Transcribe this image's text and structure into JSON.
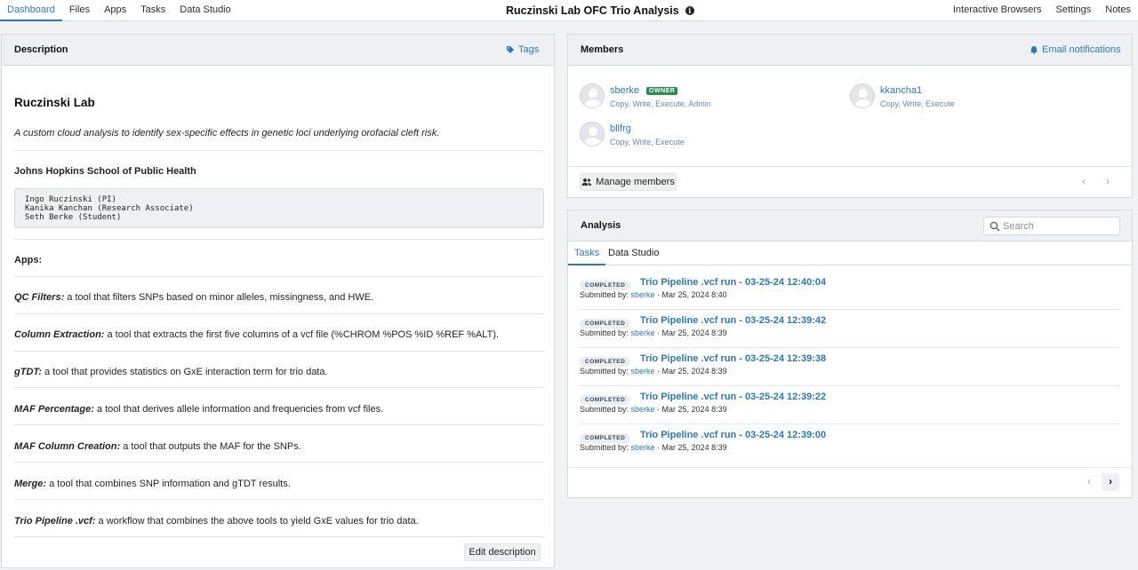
{
  "nav": {
    "left": [
      "Dashboard",
      "Files",
      "Apps",
      "Tasks",
      "Data Studio"
    ],
    "title": "Ruczinski Lab OFC Trio Analysis",
    "right": [
      "Interactive Browsers",
      "Settings",
      "Notes"
    ]
  },
  "description": {
    "heading": "Description",
    "tags_label": "Tags",
    "lab_title": "Ruczinski Lab",
    "lab_desc": "A custom cloud analysis to identify sex-specific effects in genetic loci underlying orofacial cleft risk.",
    "school": "Johns Hopkins School of Public Health",
    "people": "Ingo Ruczinski (PI)\nKanika Kanchan (Research Associate)\nSeth Berke (Student)",
    "apps_label": "Apps:",
    "tools": [
      {
        "name": "QC Filters:",
        "desc": " a tool that filters SNPs based on minor alleles, missingness, and HWE."
      },
      {
        "name": "Column Extraction:",
        "desc": " a tool that extracts the first five columns of a vcf file (%CHROM %POS %ID %REF %ALT)."
      },
      {
        "name": "gTDT:",
        "desc": " a tool that provides statistics on GxE interaction term for trio data."
      },
      {
        "name": "MAF Percentage:",
        "desc": " a tool that derives allele information and frequencies from vcf files."
      },
      {
        "name": "MAF Column Creation:",
        "desc": " a tool that outputs the MAF for the SNPs."
      },
      {
        "name": "Merge:",
        "desc": " a tool that combines SNP information and gTDT results."
      },
      {
        "name": "Trio Pipeline .vcf:",
        "desc": " a workflow that combines the above tools to yield GxE values for trio data."
      }
    ],
    "edit_label": "Edit description"
  },
  "members": {
    "heading": "Members",
    "email_label": "Email notifications",
    "list": [
      {
        "name": "sberke",
        "badge": "OWNER",
        "perms": "Copy, Write, Execute, Admin"
      },
      {
        "name": "kkancha1",
        "badge": "",
        "perms": "Copy, Write, Execute"
      },
      {
        "name": "bllfrg",
        "badge": "",
        "perms": "Copy, Write, Execute"
      }
    ],
    "manage_label": "Manage members"
  },
  "analysis": {
    "heading": "Analysis",
    "search_placeholder": "Search",
    "tabs": [
      "Tasks",
      "Data Studio"
    ],
    "submitted_prefix": "Submitted by: ",
    "runs": [
      {
        "status": "COMPLETED",
        "title": "Trio Pipeline .vcf run - 03-25-24 12:40:04",
        "user": "sberke",
        "date": " · Mar 25, 2024 8:40"
      },
      {
        "status": "COMPLETED",
        "title": "Trio Pipeline .vcf run - 03-25-24 12:39:42",
        "user": "sberke",
        "date": " · Mar 25, 2024 8:39"
      },
      {
        "status": "COMPLETED",
        "title": "Trio Pipeline .vcf run - 03-25-24 12:39:38",
        "user": "sberke",
        "date": " · Mar 25, 2024 8:39"
      },
      {
        "status": "COMPLETED",
        "title": "Trio Pipeline .vcf run - 03-25-24 12:39:22",
        "user": "sberke",
        "date": " · Mar 25, 2024 8:39"
      },
      {
        "status": "COMPLETED",
        "title": "Trio Pipeline .vcf run - 03-25-24 12:39:00",
        "user": "sberke",
        "date": " · Mar 25, 2024 8:39"
      }
    ]
  },
  "colors": {
    "accent": "#2a7ab8",
    "owner_badge": "#2e8b57"
  }
}
